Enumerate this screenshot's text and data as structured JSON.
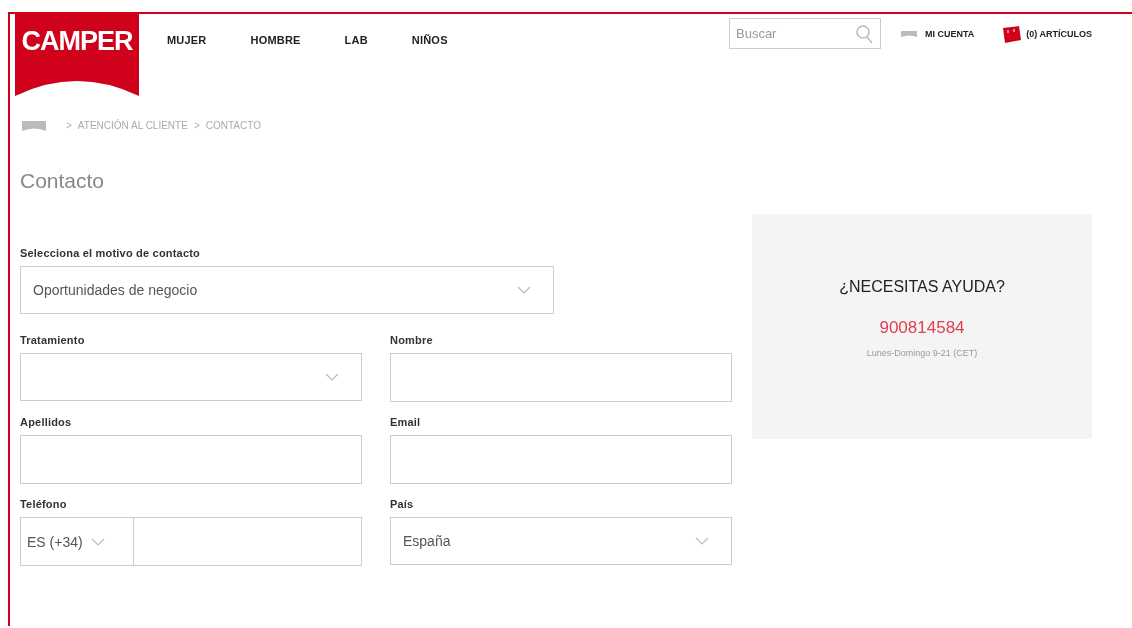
{
  "logo": "CAMPER",
  "nav": [
    "MUJER",
    "HOMBRE",
    "LAB",
    "NIÑOS"
  ],
  "search": {
    "placeholder": "Buscar"
  },
  "account": "MI CUENTA",
  "cart": "(0) ARTÍCULOS",
  "breadcrumb": [
    {
      "separator": ">",
      "label": "ATENCIÓN AL CLIENTE"
    },
    {
      "separator": ">",
      "label": "CONTACTO"
    }
  ],
  "title": "Contacto",
  "reason": {
    "label": "Selecciona el motivo de contacto",
    "value": "Oportunidades de negocio"
  },
  "fields": [
    {
      "kind": "select",
      "label": "Tratamiento"
    },
    {
      "kind": "text",
      "label": "Nombre"
    },
    {
      "kind": "text",
      "label": "Apellidos"
    },
    {
      "kind": "text",
      "label": "Email"
    },
    {
      "kind": "phone",
      "label": "Teléfono",
      "prefix": "ES (+34)"
    },
    {
      "kind": "select",
      "label": "País",
      "value": "España"
    }
  ],
  "help": {
    "title": "¿NECESITAS AYUDA?",
    "phone": "900814584",
    "hours": "Lunes-Domingo 9-21 (CET)"
  }
}
